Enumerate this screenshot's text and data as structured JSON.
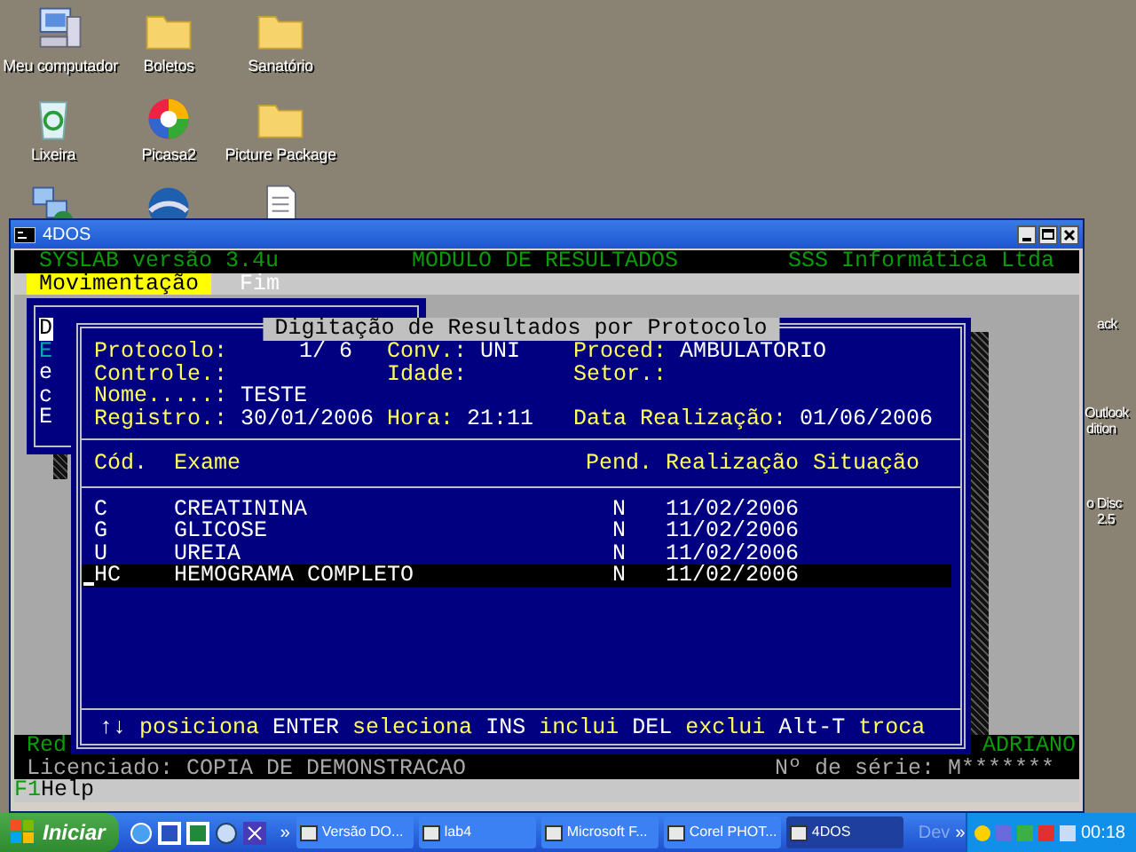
{
  "desktop_icons": [
    {
      "label": "Meu computador",
      "kind": "computer"
    },
    {
      "label": "Boletos",
      "kind": "folder"
    },
    {
      "label": "Sanatório",
      "kind": "folder"
    },
    {
      "label": "Lixeira",
      "kind": "recycle"
    },
    {
      "label": "Picasa2",
      "kind": "picasa"
    },
    {
      "label": "Picture Package",
      "kind": "folder"
    },
    {
      "kind": "network"
    },
    {
      "kind": "globe"
    },
    {
      "kind": "document"
    }
  ],
  "desktop_edge_labels": [
    "ack",
    "Outlook",
    "dition",
    "o Disc",
    "2.5"
  ],
  "window": {
    "title": "4DOS"
  },
  "console": {
    "header": {
      "app": "SYSLAB versão 3.4u",
      "module": "MODULO DE RESULTADOS",
      "company": "SSS Informática Ltda"
    },
    "menu": [
      {
        "label": "Movimentação",
        "selected": true
      },
      {
        "label": "Fim",
        "selected": false
      }
    ],
    "back_menu": [
      {
        "label": "D",
        "selected": true,
        "color": "#000000"
      },
      {
        "label": "E",
        "selected": false,
        "color": "#00aaaa"
      },
      {
        "label": "e",
        "selected": false,
        "color": "#ffffff"
      },
      {
        "label": "c",
        "selected": false,
        "color": "#ffffff"
      },
      {
        "label": "E",
        "selected": false,
        "color": "#ffffff"
      }
    ],
    "dialog": {
      "title": "Digitação de Resultados por Protocolo",
      "fields": [
        [
          {
            "label": "Protocolo:",
            "value": "1/ 6",
            "kind": "number"
          },
          {
            "label": "Conv.:",
            "value": "UNI"
          },
          {
            "label": "Proced:",
            "value": "AMBULATORIO"
          }
        ],
        [
          {
            "label": "Controle.:"
          },
          {
            "label": "Idade:"
          },
          {
            "label": "Setor.:"
          }
        ],
        [
          {
            "label": "Nome.....:",
            "value": "TESTE"
          }
        ],
        [
          {
            "label": "Registro.:",
            "value": "30/01/2006"
          },
          {
            "label": "Hora:",
            "value": "21:11"
          },
          {
            "label": "Data Realização:",
            "value": "01/06/2006"
          }
        ]
      ],
      "columns": [
        "Cód.",
        "Exame",
        "Pend.",
        "Realização",
        "Situação"
      ],
      "rows": [
        {
          "code": "C",
          "exam": "CREATININA",
          "pend": "N",
          "date": "11/02/2006",
          "selected": false
        },
        {
          "code": "G",
          "exam": "GLICOSE",
          "pend": "N",
          "date": "11/02/2006",
          "selected": false
        },
        {
          "code": "U",
          "exam": "UREIA",
          "pend": "N",
          "date": "11/02/2006",
          "selected": false
        },
        {
          "code": "HC",
          "exam": "HEMOGRAMA COMPLETO",
          "pend": "N",
          "date": "11/02/2006",
          "selected": true
        }
      ],
      "hints": [
        {
          "key": "↑↓",
          "action": "posiciona"
        },
        {
          "key": "ENTER",
          "action": "seleciona"
        },
        {
          "key": "INS",
          "action": "inclui"
        },
        {
          "key": "DEL",
          "action": "exclui"
        },
        {
          "key": "Alt-T",
          "action": "troca"
        }
      ]
    },
    "status": {
      "left": "Red",
      "user": "ADRIANO",
      "license": "Licenciado: COPIA DE DEMONSTRACAO",
      "serial": "Nº de série: M*******"
    },
    "help": {
      "key": "F1",
      "label": "Help"
    }
  },
  "taskbar": {
    "start": "Iniciar",
    "more": "»",
    "tasks": [
      {
        "label": "Versão DO...",
        "selected": false
      },
      {
        "label": "lab4",
        "selected": false
      },
      {
        "label": "Microsoft F...",
        "selected": false
      },
      {
        "label": "Corel PHOT...",
        "selected": false
      },
      {
        "label": "4DOS",
        "selected": true
      }
    ],
    "toolbar_label": "Dev",
    "toolbar_more": "»",
    "clock": "00:18"
  }
}
